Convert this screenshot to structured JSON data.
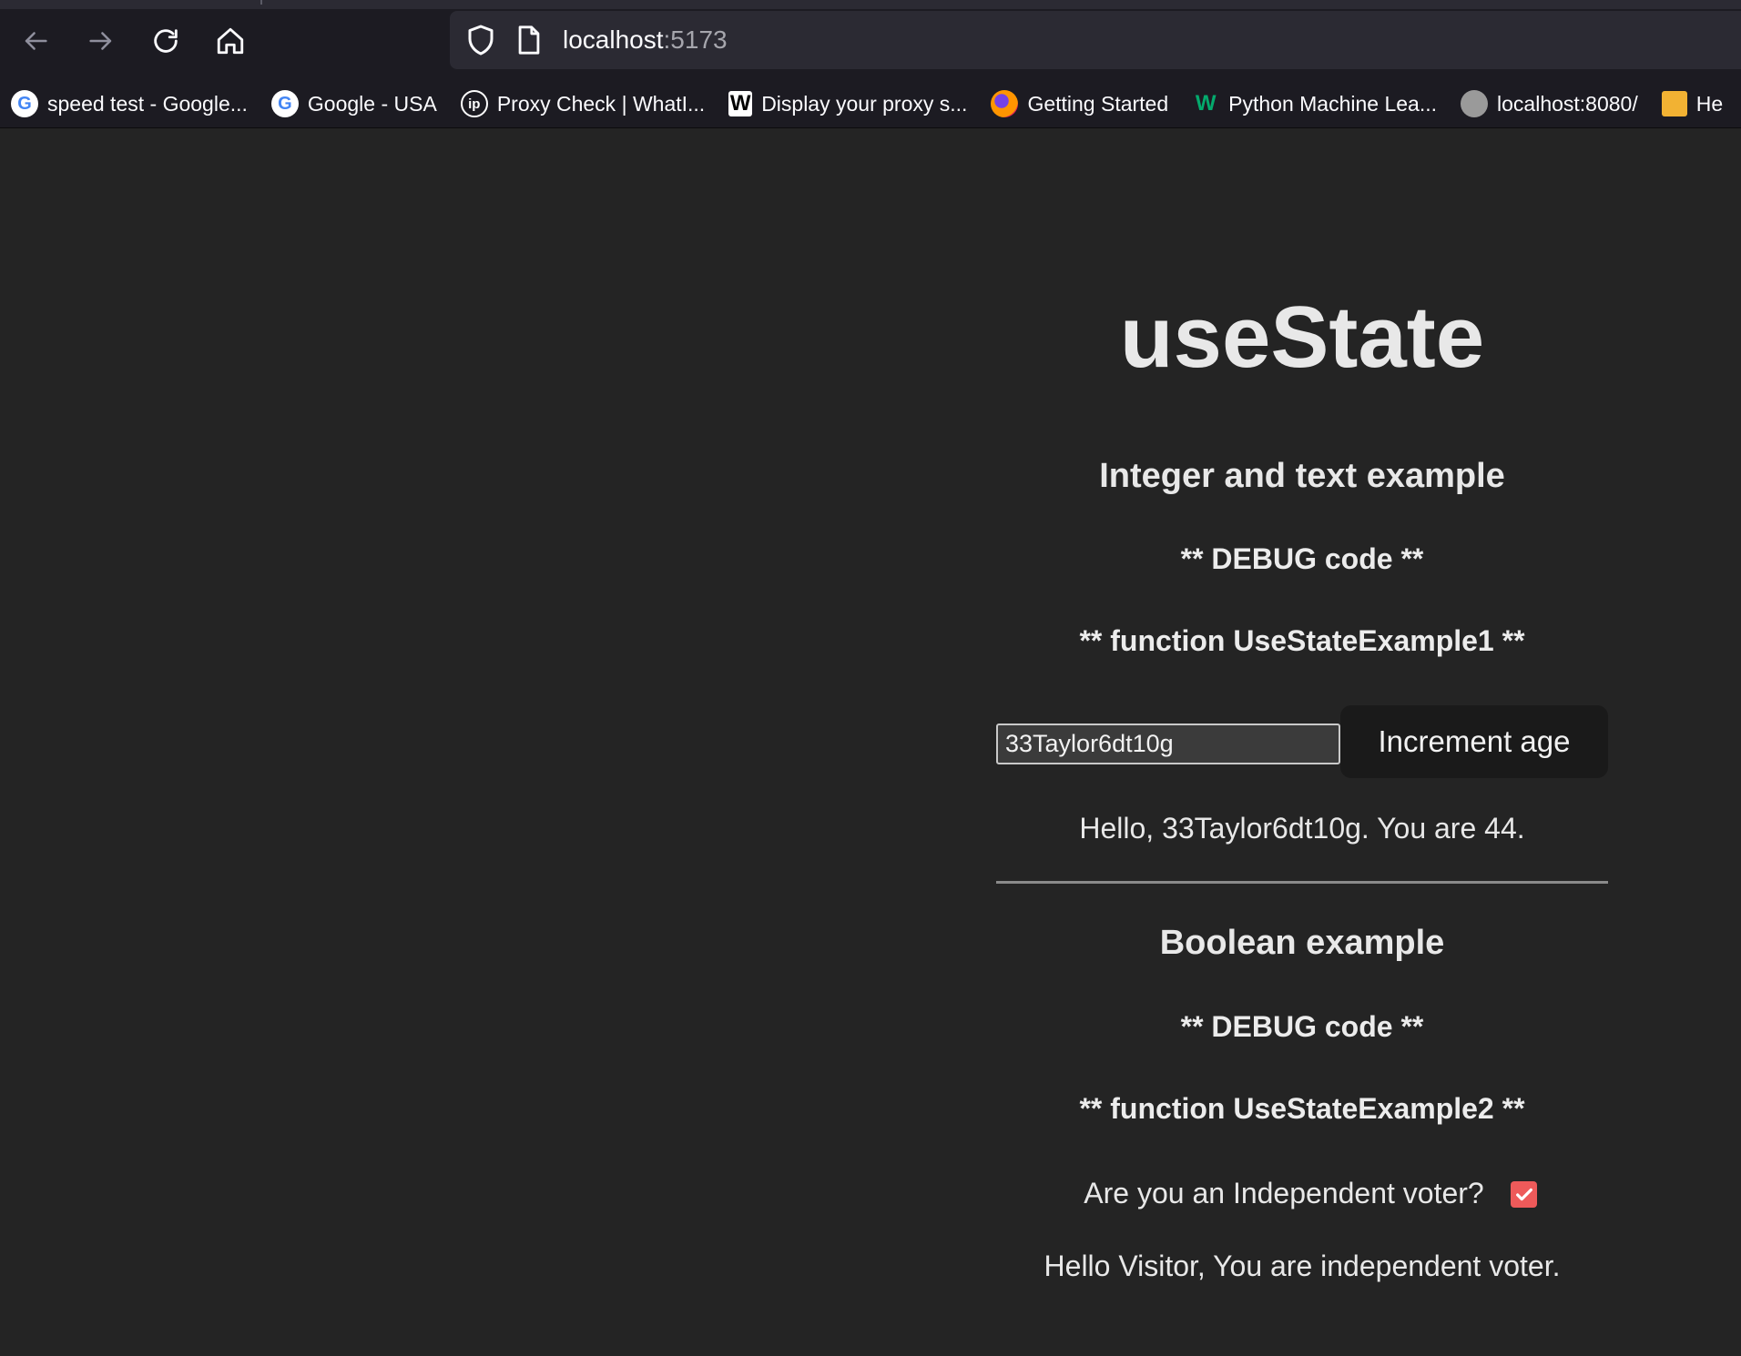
{
  "browser": {
    "url_host": "localhost",
    "url_port": ":5173",
    "bookmarks": [
      {
        "label": "speed test - Google...",
        "icon": "google-icon"
      },
      {
        "label": "Google - USA",
        "icon": "google-icon"
      },
      {
        "label": "Proxy Check | WhatI...",
        "icon": "ip-icon"
      },
      {
        "label": "Display your proxy s...",
        "icon": "w-icon"
      },
      {
        "label": "Getting Started",
        "icon": "firefox-icon"
      },
      {
        "label": "Python Machine Lea...",
        "icon": "w3-icon"
      },
      {
        "label": "localhost:8080/",
        "icon": "globe-icon"
      },
      {
        "label": "He",
        "icon": "box-icon"
      }
    ]
  },
  "page": {
    "title": "useState",
    "section1": {
      "heading": "Integer and text example",
      "debug": "** DEBUG code **",
      "function": "** function UseStateExample1 **",
      "input_value": "33Taylor6dt10g",
      "button_label": "Increment age",
      "message": "Hello, 33Taylor6dt10g. You are 44."
    },
    "section2": {
      "heading": "Boolean example",
      "debug": "** DEBUG code **",
      "function": "** function UseStateExample2 **",
      "question": "Are you an Independent voter?",
      "checked": true,
      "message": "Hello Visitor, You are independent voter."
    }
  },
  "colors": {
    "page_bg": "#242424",
    "checkbox_accent": "#ee5a5a",
    "button_bg": "#1a1a1a"
  }
}
